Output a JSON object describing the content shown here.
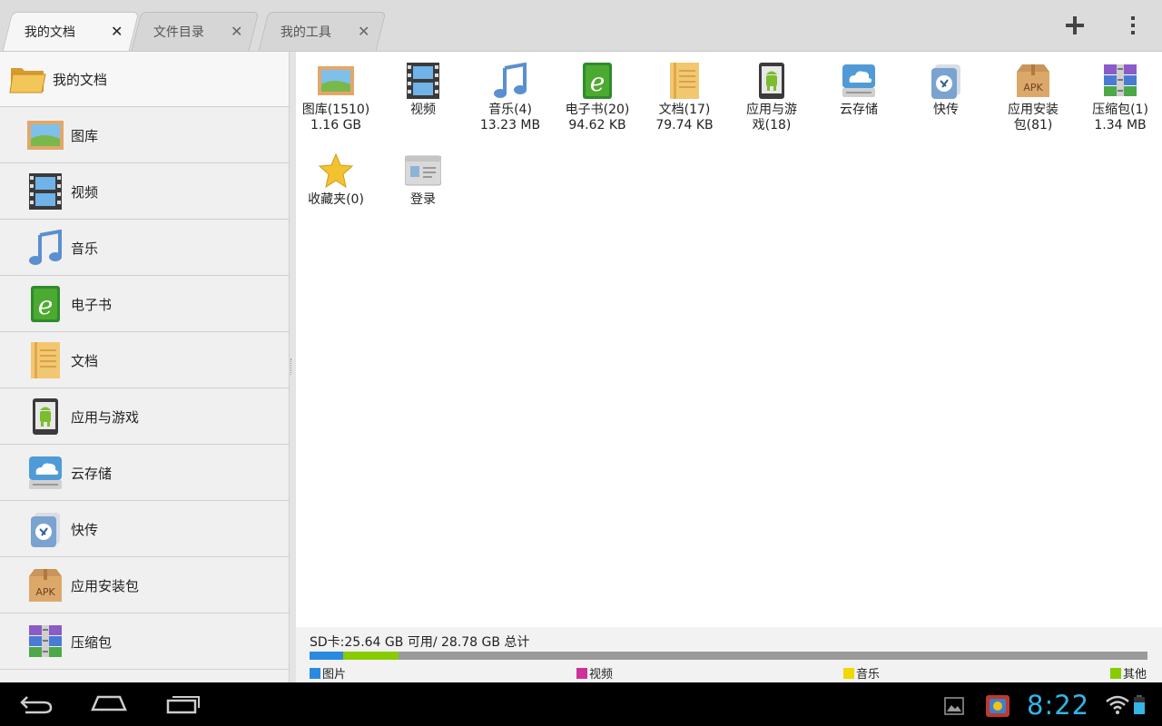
{
  "tabs": [
    {
      "label": "我的文档",
      "active": true
    },
    {
      "label": "文件目录",
      "active": false
    },
    {
      "label": "我的工具",
      "active": false
    }
  ],
  "actions": {
    "add_icon": "plus-icon",
    "menu_icon": "overflow-menu-icon"
  },
  "sidebar": {
    "header": "我的文档",
    "items": [
      {
        "label": "图库",
        "icon": "gallery-icon"
      },
      {
        "label": "视频",
        "icon": "video-icon"
      },
      {
        "label": "音乐",
        "icon": "music-icon"
      },
      {
        "label": "电子书",
        "icon": "ebook-icon"
      },
      {
        "label": "文档",
        "icon": "document-icon"
      },
      {
        "label": "应用与游戏",
        "icon": "app-icon"
      },
      {
        "label": "云存储",
        "icon": "cloud-icon"
      },
      {
        "label": "快传",
        "icon": "quick-transfer-icon"
      },
      {
        "label": "应用安装包",
        "icon": "apk-icon"
      },
      {
        "label": "压缩包",
        "icon": "archive-icon"
      }
    ]
  },
  "grid": [
    {
      "line1": "图库(1510)",
      "line2": "1.16 GB",
      "icon": "gallery-icon"
    },
    {
      "line1": "视频",
      "line2": "",
      "icon": "video-icon"
    },
    {
      "line1": "音乐(4)",
      "line2": "13.23 MB",
      "icon": "music-icon"
    },
    {
      "line1": "电子书(20)",
      "line2": "94.62 KB",
      "icon": "ebook-icon"
    },
    {
      "line1": "文档(17)",
      "line2": "79.74 KB",
      "icon": "document-icon"
    },
    {
      "line1": "应用与游",
      "line2": "戏(18)",
      "icon": "app-icon"
    },
    {
      "line1": "云存储",
      "line2": "",
      "icon": "cloud-icon"
    },
    {
      "line1": "快传",
      "line2": "",
      "icon": "quick-transfer-icon"
    },
    {
      "line1": "应用安装",
      "line2": "包(81)",
      "icon": "apk-icon"
    },
    {
      "line1": "压缩包(1)",
      "line2": "1.34 MB",
      "icon": "archive-icon"
    },
    {
      "line1": "收藏夹(0)",
      "line2": "",
      "icon": "favorites-icon"
    },
    {
      "line1": "登录",
      "line2": "",
      "icon": "login-icon"
    }
  ],
  "storage": {
    "text": "SD卡:25.64 GB 可用/ 28.78 GB 总计",
    "segments": [
      {
        "name": "图片",
        "fraction": 0.04,
        "color": "#2a8ae0"
      },
      {
        "name": "视频",
        "fraction": 0.0,
        "color": "#cc3399"
      },
      {
        "name": "音乐",
        "fraction": 0.0,
        "color": "#f0d800"
      },
      {
        "name": "其他",
        "fraction": 0.066,
        "color": "#88cc00"
      }
    ],
    "legend": [
      {
        "label": "图片",
        "color": "#2a8ae0"
      },
      {
        "label": "视频",
        "color": "#cc3399"
      },
      {
        "label": "音乐",
        "color": "#f0d800"
      },
      {
        "label": "其他",
        "color": "#88cc00"
      }
    ]
  },
  "statusbar": {
    "time": "8:22"
  }
}
